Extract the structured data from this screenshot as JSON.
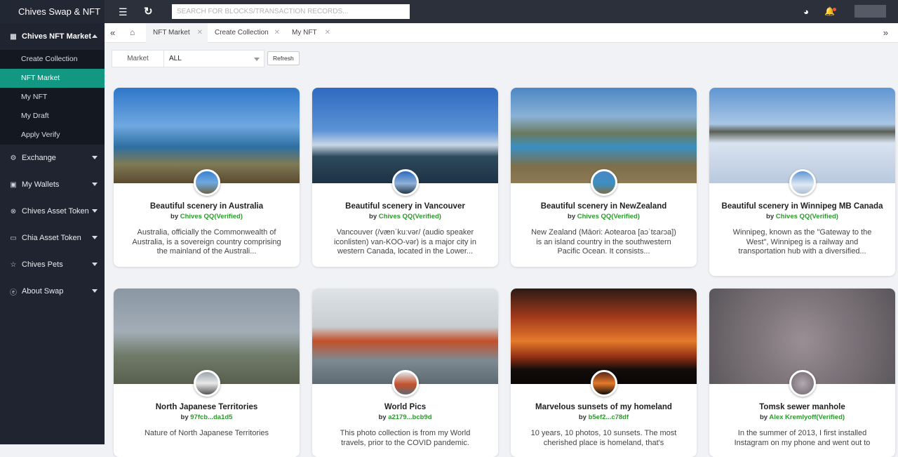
{
  "app": {
    "title": "Chives Swap & NFT"
  },
  "sidebar": {
    "groups": [
      {
        "label": "Chives NFT Market",
        "icon": "market-icon",
        "items": [
          "Create Collection",
          "NFT Market",
          "My NFT",
          "My Draft",
          "Apply Verify"
        ],
        "selected": "NFT Market"
      },
      {
        "label": "Exchange",
        "icon": "exchange-icon"
      },
      {
        "label": "My Wallets",
        "icon": "wallet-icon"
      },
      {
        "label": "Chives Asset Token",
        "icon": "token-icon"
      },
      {
        "label": "Chia Asset Token",
        "icon": "chia-token-icon"
      },
      {
        "label": "Chives Pets",
        "icon": "star-icon"
      },
      {
        "label": "About Swap",
        "icon": "info-icon"
      }
    ]
  },
  "topbar": {
    "search_placeholder": "SEARCH FOR BLOCKS/TRANSACTION RECORDS..."
  },
  "tabs": [
    {
      "label": "NFT Market",
      "active": true
    },
    {
      "label": "Create Collection",
      "active": false
    },
    {
      "label": "My NFT",
      "active": false
    }
  ],
  "filter": {
    "label": "Market",
    "selected": "ALL",
    "refresh_label": "Refresh"
  },
  "colors": {
    "accent": "#119782",
    "sidebar": "#1f2430",
    "author": "#2d9a2d"
  },
  "cards": [
    {
      "title": "Beautiful scenery in Australia",
      "by": "by",
      "author": "Chives QQ(Verified)",
      "desc": "Australia, officially the Commonwealth of Australia, is a sovereign country comprising the mainland of the Australi..."
    },
    {
      "title": "Beautiful scenery in Vancouver",
      "by": "by",
      "author": "Chives QQ(Verified)",
      "desc": "Vancouver (/vænˈkuːvər/ (audio speaker iconlisten) van-KOO-vər) is a major city in western Canada, located in the Lower..."
    },
    {
      "title": "Beautiful scenery in NewZealand",
      "by": "by",
      "author": "Chives QQ(Verified)",
      "desc": "New Zealand (Māori: Aotearoa [aɔˈtɛaɾɔa]) is an island country in the southwestern Pacific Ocean. It consists..."
    },
    {
      "title": "Beautiful scenery in Winnipeg MB Canada",
      "by": "by",
      "author": "Chives QQ(Verified)",
      "desc": "Winnipeg, known as the \"Gateway to the West\", Winnipeg is a railway and transportation hub with a diversified..."
    },
    {
      "title": "North Japanese Territories",
      "by": "by",
      "author": "97fcb...da1d5",
      "desc": "Nature of North Japanese Territories"
    },
    {
      "title": "World Pics",
      "by": "by",
      "author": "a2179...bcb9d",
      "desc": "This photo collection is from my World travels, prior to the COVID pandemic."
    },
    {
      "title": "Marvelous sunsets of my homeland",
      "by": "by",
      "author": "b5ef2...c78df",
      "desc": "10 years, 10 photos, 10 sunsets. The most cherished place is homeland, that's"
    },
    {
      "title": "Tomsk sewer manhole",
      "by": "by",
      "author": "Alex Kremlyoff(Verified)",
      "desc": "In the summer of 2013, I first installed Instagram on my phone and went out to"
    }
  ]
}
